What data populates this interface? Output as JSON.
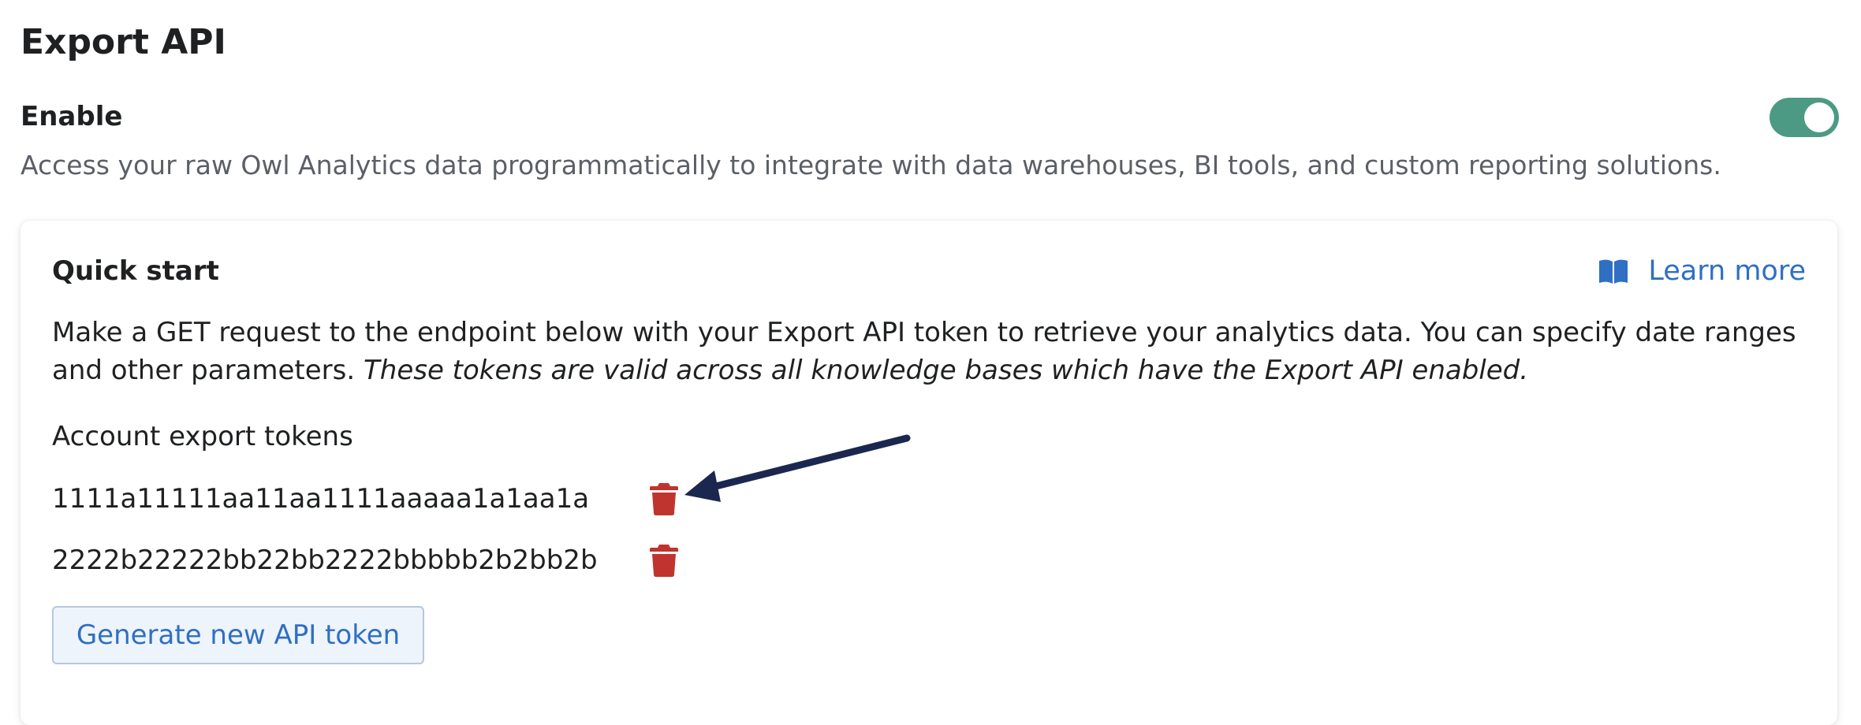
{
  "page": {
    "title": "Export API"
  },
  "enable": {
    "label": "Enable",
    "toggle_on": true,
    "description": "Access your raw Owl Analytics data programmatically to integrate with data warehouses, BI tools, and custom reporting solutions."
  },
  "quick_start": {
    "title": "Quick start",
    "learn_more_label": "Learn more",
    "learn_more_icon": "book-open-icon",
    "intro_text": "Make a GET request to the endpoint below with your Export API token to retrieve your analytics data. You can specify date ranges and other parameters.",
    "intro_note": "These tokens are valid across all knowledge bases which have the Export API enabled.",
    "tokens_heading": "Account export tokens",
    "tokens": [
      {
        "value": "1111a11111aa11aa1111aaaaa1a1aa1a",
        "delete_icon": "trash-icon"
      },
      {
        "value": "2222b22222bb22bb2222bbbbb2b2bb2b",
        "delete_icon": "trash-icon"
      }
    ],
    "generate_button_label": "Generate new API token"
  },
  "colors": {
    "toggle_on": "#4c9a84",
    "link": "#2f6fc4",
    "trash": "#c0342f",
    "annotation_arrow": "#1c2750",
    "button_bg": "#eef4fb",
    "button_border": "#b7c7de"
  }
}
